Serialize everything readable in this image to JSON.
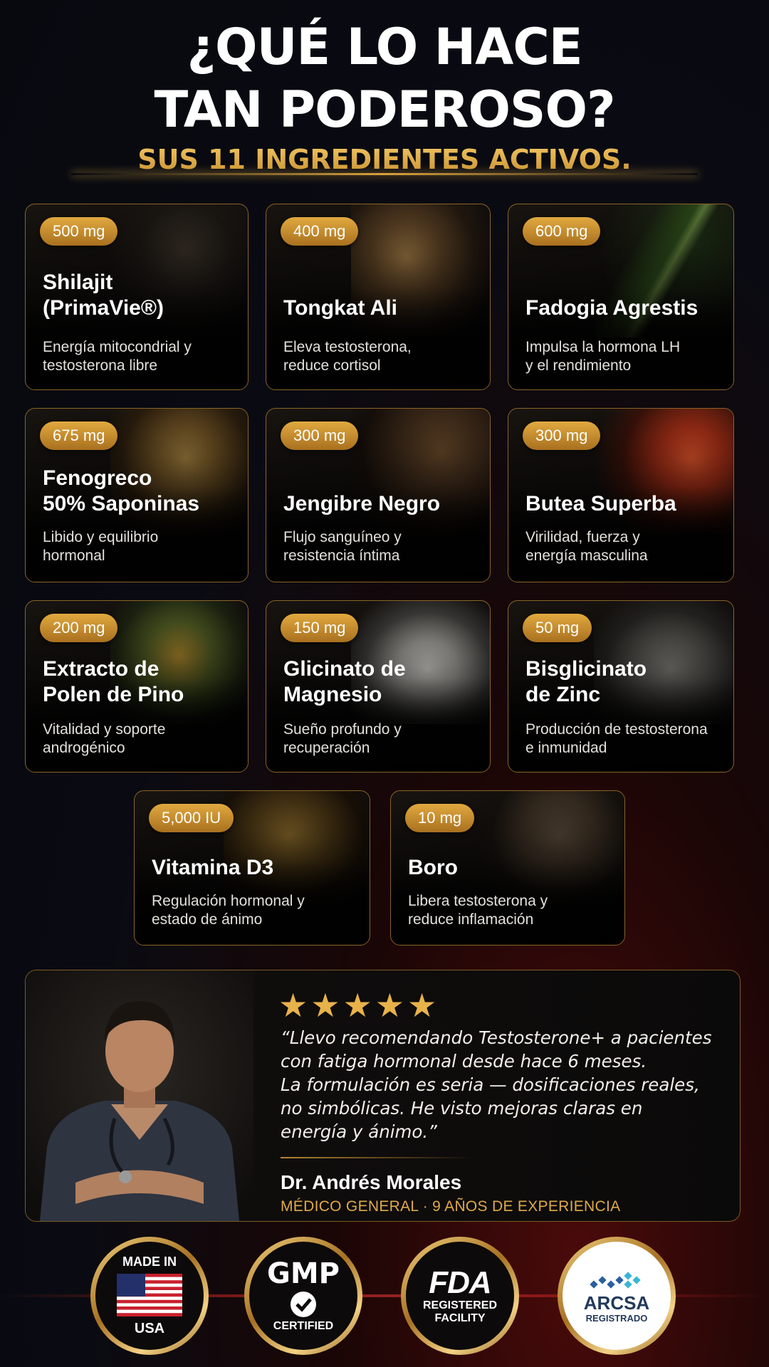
{
  "header": {
    "title_line1": "¿QUÉ LO HACE",
    "title_line2": "TAN PODEROSO?",
    "subtitle": "SUS 11 INGREDIENTES ACTIVOS."
  },
  "ingredients": [
    {
      "dose": "500 mg",
      "name_l1": "Shilajit",
      "name_l2": "(PrimaVie®)",
      "desc_l1": "Energía mitocondrial y",
      "desc_l2": "testosterona libre"
    },
    {
      "dose": "400 mg",
      "name_l1": "",
      "name_l2": "Tongkat Ali",
      "desc_l1": "Eleva testosterona,",
      "desc_l2": "reduce cortisol"
    },
    {
      "dose": "600 mg",
      "name_l1": "",
      "name_l2": "Fadogia Agrestis",
      "desc_l1": "Impulsa la hormona LH",
      "desc_l2": "y el rendimiento"
    },
    {
      "dose": "675 mg",
      "name_l1": "Fenogreco",
      "name_l2": "50% Saponinas",
      "desc_l1": "Libido y equilibrio",
      "desc_l2": "hormonal"
    },
    {
      "dose": "300 mg",
      "name_l1": "",
      "name_l2": "Jengibre Negro",
      "desc_l1": "Flujo sanguíneo y",
      "desc_l2": "resistencia íntima"
    },
    {
      "dose": "300 mg",
      "name_l1": "",
      "name_l2": "Butea Superba",
      "desc_l1": "Virilidad, fuerza y",
      "desc_l2": "energía masculina"
    },
    {
      "dose": "200 mg",
      "name_l1": "Extracto de",
      "name_l2": "Polen de Pino",
      "desc_l1": "Vitalidad y soporte",
      "desc_l2": "androgénico"
    },
    {
      "dose": "150 mg",
      "name_l1": "Glicinato de",
      "name_l2": "Magnesio",
      "desc_l1": "Sueño profundo y",
      "desc_l2": "recuperación"
    },
    {
      "dose": "50 mg",
      "name_l1": "Bisglicinato",
      "name_l2": "de Zinc",
      "desc_l1": "Producción de testosterona",
      "desc_l2": "e inmunidad"
    },
    {
      "dose": "5,000 IU",
      "name_l1": "",
      "name_l2": "Vitamina D3",
      "desc_l1": "Regulación hormonal y",
      "desc_l2": "estado de ánimo"
    },
    {
      "dose": "10 mg",
      "name_l1": "",
      "name_l2": "Boro",
      "desc_l1": "Libera testosterona y",
      "desc_l2": "reduce inflamación"
    }
  ],
  "testimonial": {
    "stars": "★★★★★",
    "quote_l1": "“Llevo recomendando Testosterone+ a pacientes",
    "quote_l2": "con fatiga hormonal desde hace 6 meses.",
    "quote_l3": "La formulación es seria — dosificaciones reales,",
    "quote_l4": "no simbólicas. He visto mejoras claras en",
    "quote_l5": "energía y ánimo.”",
    "name": "Dr. Andrés Morales",
    "title": "MÉDICO GENERAL · 9 AÑOS DE EXPERIENCIA"
  },
  "badges": {
    "usa_top": "MADE IN",
    "usa_bottom": "USA",
    "gmp": "GMP",
    "gmp_sub": "CERTIFIED",
    "fda": "FDA",
    "fda_sub1": "REGISTERED",
    "fda_sub2": "FACILITY",
    "arcsa": "ARCSA",
    "arcsa_sub": "REGISTRADO"
  },
  "colors": {
    "accent_gold": "#e0a94a",
    "card_border": "#8a6428",
    "background": "#07090f"
  }
}
